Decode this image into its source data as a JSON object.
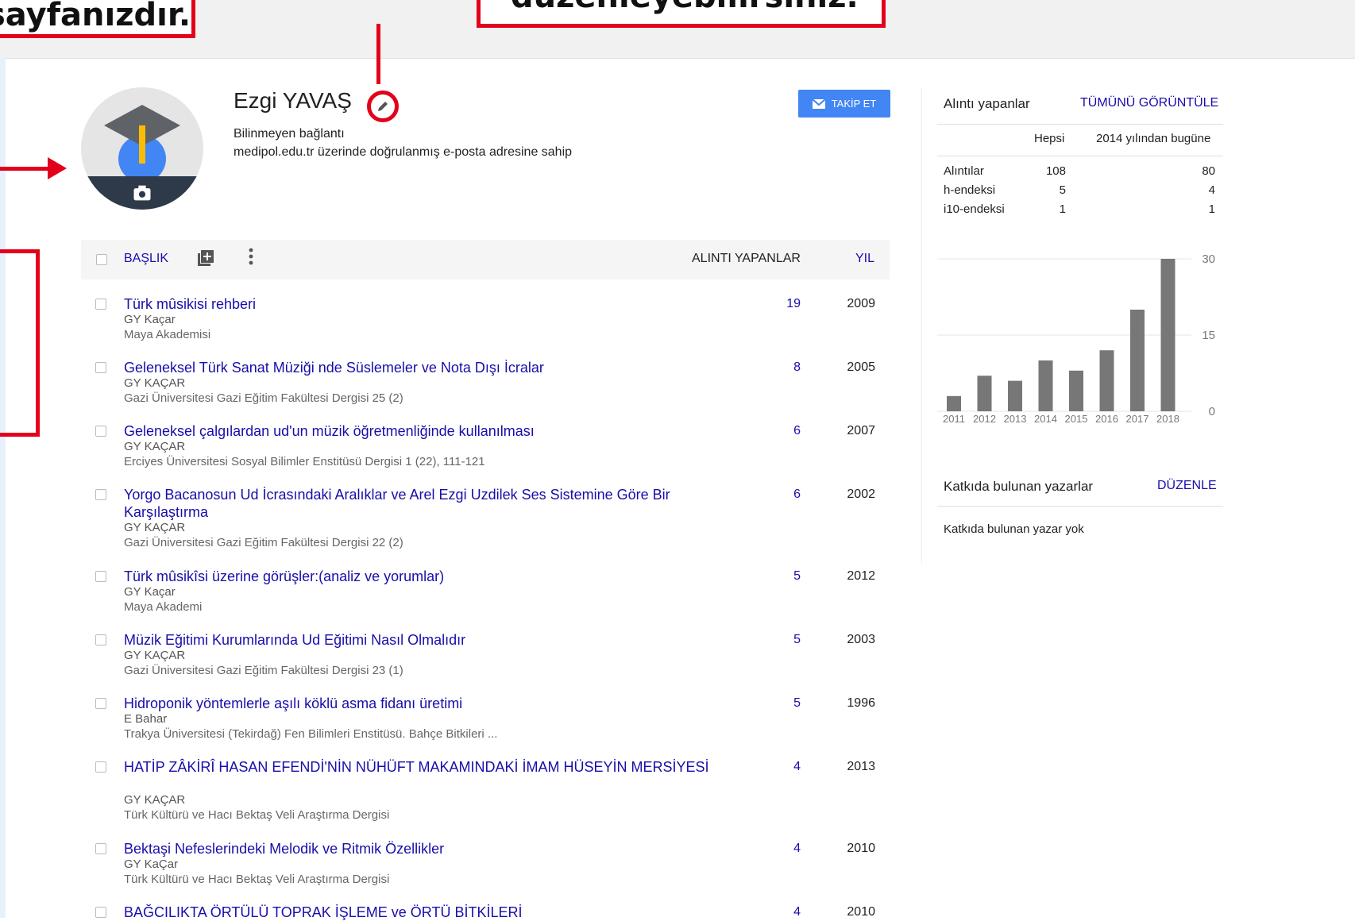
{
  "callouts": {
    "left_text": "sayfanızdır.",
    "right_text": "düzenleyebilirsiniz."
  },
  "profile": {
    "name": "Ezgi YAVAŞ",
    "affiliation": "Bilinmeyen bağlantı",
    "email_note": "medipol.edu.tr üzerinde doğrulanmış e-posta adresine sahip",
    "follow_label": "TAKİP ET"
  },
  "table": {
    "col_title": "BAŞLIK",
    "col_cited": "ALINTI YAPANLAR",
    "col_year": "YIL",
    "rows": [
      {
        "title": "Türk mûsikisi rehberi",
        "authors": "GY Kaçar",
        "venue": "Maya Akademisi",
        "cited": "19",
        "year": "2009"
      },
      {
        "title": "Geleneksel Türk Sanat Müziği nde Süslemeler ve Nota Dışı İcralar",
        "authors": "GY KAÇAR",
        "venue": "Gazi Üniversitesi Gazi Eğitim Fakültesi Dergisi 25 (2)",
        "cited": "8",
        "year": "2005"
      },
      {
        "title": "Geleneksel çalgılardan ud'un müzik öğretmenliğinde kullanılması",
        "authors": "GY KAÇAR",
        "venue": "Erciyes Üniversitesi Sosyal Bilimler Enstitüsü Dergisi 1 (22), 111-121",
        "cited": "6",
        "year": "2007"
      },
      {
        "title": "Yorgo Bacanosun Ud İcrasındaki Aralıklar ve Arel Ezgi Uzdilek Ses Sistemine Göre Bir Karşılaştırma",
        "authors": "GY KAÇAR",
        "venue": "Gazi Üniversitesi Gazi Eğitim Fakültesi Dergisi 22 (2)",
        "cited": "6",
        "year": "2002"
      },
      {
        "title": "Türk mûsikîsi üzerine görüşler:(analiz ve yorumlar)",
        "authors": "GY Kaçar",
        "venue": "Maya Akademi",
        "cited": "5",
        "year": "2012"
      },
      {
        "title": "Müzik Eğitimi Kurumlarında Ud Eğitimi Nasıl Olmalıdır",
        "authors": "GY KAÇAR",
        "venue": "Gazi Üniversitesi Gazi Eğitim Fakültesi Dergisi 23 (1)",
        "cited": "5",
        "year": "2003"
      },
      {
        "title": "Hidroponik yöntemlerle aşılı köklü asma fidanı üretimi",
        "authors": "E Bahar",
        "venue": "Trakya Üniversitesi (Tekirdağ) Fen Bilimleri Enstitüsü. Bahçe Bitkileri ...",
        "cited": "5",
        "year": "1996"
      },
      {
        "title": "HATİP ZÂKİRÎ HASAN EFENDİ'NİN NÜHÜFT MAKAMINDAKİ İMAM HÜSEYİN MERSİYESİ",
        "authors": "GY KAÇAR",
        "venue": "Türk Kültürü ve Hacı Bektaş Veli Araştırma Dergisi",
        "cited": "4",
        "year": "2013"
      },
      {
        "title": "Bektaşi Nefeslerindeki Melodik ve Ritmik Özellikler",
        "authors": "GY KaÇar",
        "venue": "Türk Kültürü ve Hacı Bektaş Veli Araştırma Dergisi",
        "cited": "4",
        "year": "2010"
      },
      {
        "title": "BAĞCILIKTA ÖRTÜLÜ TOPRAK İŞLEME ve ÖRTÜ BİTKİLERİ",
        "authors": "",
        "venue": "",
        "cited": "4",
        "year": "2010"
      }
    ]
  },
  "sidebar": {
    "cited_by_title": "Alıntı yapanlar",
    "view_all": "TÜMÜNÜ GÖRÜNTÜLE",
    "col_all": "Hepsi",
    "col_since": "2014 yılından bugüne",
    "metrics": [
      {
        "label": "Alıntılar",
        "all": "108",
        "since": "80"
      },
      {
        "label": "h-endeksi",
        "all": "5",
        "since": "4"
      },
      {
        "label": "i10-endeksi",
        "all": "1",
        "since": "1"
      }
    ],
    "coauthors_title": "Katkıda bulunan yazarlar",
    "coauthors_edit": "DÜZENLE",
    "coauthors_none": "Katkıda bulunan yazar yok"
  },
  "chart_data": {
    "type": "bar",
    "categories": [
      "2011",
      "2012",
      "2013",
      "2014",
      "2015",
      "2016",
      "2017",
      "2018"
    ],
    "values": [
      3,
      7,
      6,
      10,
      8,
      12,
      20,
      30
    ],
    "ylim": [
      0,
      30
    ],
    "yticks": [
      "30",
      "15",
      "0"
    ],
    "bar_color": "#777777"
  },
  "colors": {
    "accent_red": "#e3001b",
    "link_blue": "#1a0dab",
    "button_blue": "#4285f4"
  }
}
